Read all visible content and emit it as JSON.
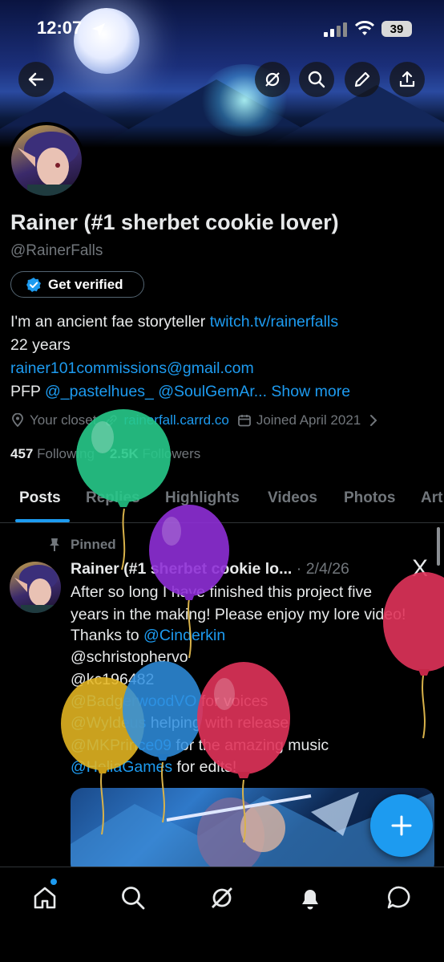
{
  "status_bar": {
    "time": "12:07",
    "battery": "39"
  },
  "profile": {
    "name": "Rainer (#1 sherbet cookie lover)",
    "handle": "@RainerFalls",
    "verify_label": "Get verified",
    "bio_line1_text": "I'm an ancient fae storyteller ",
    "bio_line1_link": "twitch.tv/rainerfalls",
    "bio_line2": "22 years",
    "bio_line3_link": "rainer101commissions@gmail.com",
    "bio_line4_prefix": "PFP ",
    "bio_line4_link1": "@_pastelhues_",
    "bio_line4_link2": "@SoulGemAr...",
    "show_more": "Show more",
    "location": "Your closet",
    "website": "rainerfall.carrd.co",
    "joined": "Joined April 2021",
    "following_count": "457",
    "following_label": "Following",
    "followers_count": "2.5K",
    "followers_label": "Followers"
  },
  "tabs": [
    "Posts",
    "Replies",
    "Highlights",
    "Videos",
    "Photos",
    "Art"
  ],
  "post": {
    "pinned_label": "Pinned",
    "author": "Rainer (#1 sherbet cookie lo...",
    "date": "2/4/26",
    "line1": "After so long I have finished this project five",
    "line2": "years in the making! Please enjoy my lore video!",
    "line3_prefix": "Thanks to ",
    "line3_link": "@Cinderkin",
    "line4_link": "@schristophervo",
    "line5_link": "@kc196482",
    "line6_link": "@BadgerwoodVO",
    "line6_text": " for voices",
    "line7_link": "@Wyldeus",
    "line7_text": " helping with release",
    "line8_link": "@MKPrince09",
    "line8_text": " for the amazing music",
    "line9_link": "@HeliaGames",
    "line9_text": " for edits!",
    "close_glyph": "X"
  },
  "colors": {
    "accent": "#1d9bf0",
    "muted": "#71767b",
    "balloon_green": "#27c98a",
    "balloon_purple": "#8e2fd6",
    "balloon_red": "#e0335a",
    "balloon_blue": "#2f8fe0",
    "balloon_yellow": "#e6b722"
  },
  "icons": [
    "back-arrow-icon",
    "grok-icon",
    "search-icon",
    "edit-icon",
    "share-icon",
    "location-icon",
    "link-icon",
    "calendar-icon",
    "chevron-right-icon",
    "pin-icon",
    "plus-icon",
    "home-icon",
    "search-nav-icon",
    "grok-nav-icon",
    "bell-icon",
    "messages-icon"
  ]
}
